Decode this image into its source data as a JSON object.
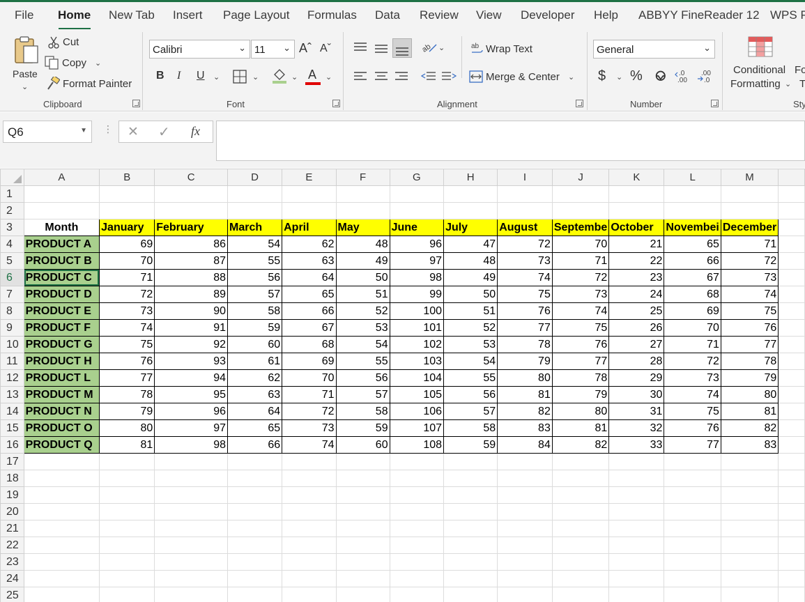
{
  "ribbon_tabs": [
    {
      "label": "File"
    },
    {
      "label": "Home"
    },
    {
      "label": "New Tab"
    },
    {
      "label": "Insert"
    },
    {
      "label": "Page Layout"
    },
    {
      "label": "Formulas"
    },
    {
      "label": "Data"
    },
    {
      "label": "Review"
    },
    {
      "label": "View"
    },
    {
      "label": "Developer"
    },
    {
      "label": "Help"
    },
    {
      "label": "ABBYY FineReader 12"
    },
    {
      "label": "WPS P"
    }
  ],
  "active_tab": "Home",
  "clipboard": {
    "paste_label": "Paste",
    "cut_label": "Cut",
    "copy_label": "Copy",
    "format_painter_label": "Format Painter",
    "group_label": "Clipboard"
  },
  "font": {
    "family": "Calibri",
    "size": "11",
    "increase_label": "Aˆ",
    "decrease_label": "Aˇ",
    "bold_label": "B",
    "italic_label": "I",
    "underline_label": "U",
    "color_label": "A",
    "group_label": "Font"
  },
  "alignment": {
    "wrap_text_label": "Wrap Text",
    "merge_center_label": "Merge & Center",
    "group_label": "Alignment"
  },
  "number": {
    "format": "General",
    "currency_label": "$",
    "percent_label": "%",
    "comma_label": "̦",
    "group_label": "Number"
  },
  "styles": {
    "conditional_label_1": "Conditional",
    "conditional_label_2": "Formatting",
    "format_label_1": "Fo",
    "format_label_2": "T",
    "group_label": "Sty"
  },
  "formula_bar": {
    "name_box": "Q6",
    "fx_label": "fx",
    "formula": ""
  },
  "sheet": {
    "columns": [
      "A",
      "B",
      "C",
      "D",
      "E",
      "F",
      "G",
      "H",
      "I",
      "J",
      "K",
      "L",
      "M"
    ],
    "row_numbers": [
      "1",
      "2",
      "3",
      "4",
      "5",
      "6",
      "7",
      "8",
      "9",
      "10",
      "11",
      "12",
      "13",
      "14",
      "15",
      "16",
      "17",
      "18",
      "19",
      "20",
      "21",
      "22",
      "23",
      "24",
      "25"
    ],
    "header_label": "Month",
    "months": [
      "January",
      "February",
      "March",
      "April",
      "May",
      "June",
      "July",
      "August",
      "Septembe",
      "October",
      "Novembei",
      "December"
    ],
    "products": [
      {
        "name": "PRODUCT A",
        "values": [
          "69",
          "86",
          "54",
          "62",
          "48",
          "96",
          "47",
          "72",
          "70",
          "21",
          "65",
          "71"
        ]
      },
      {
        "name": "PRODUCT B",
        "values": [
          "70",
          "87",
          "55",
          "63",
          "49",
          "97",
          "48",
          "73",
          "71",
          "22",
          "66",
          "72"
        ]
      },
      {
        "name": "PRODUCT C",
        "values": [
          "71",
          "88",
          "56",
          "64",
          "50",
          "98",
          "49",
          "74",
          "72",
          "23",
          "67",
          "73"
        ]
      },
      {
        "name": "PRODUCT D",
        "values": [
          "72",
          "89",
          "57",
          "65",
          "51",
          "99",
          "50",
          "75",
          "73",
          "24",
          "68",
          "74"
        ]
      },
      {
        "name": "PRODUCT E",
        "values": [
          "73",
          "90",
          "58",
          "66",
          "52",
          "100",
          "51",
          "76",
          "74",
          "25",
          "69",
          "75"
        ]
      },
      {
        "name": "PRODUCT F",
        "values": [
          "74",
          "91",
          "59",
          "67",
          "53",
          "101",
          "52",
          "77",
          "75",
          "26",
          "70",
          "76"
        ]
      },
      {
        "name": "PRODUCT G",
        "values": [
          "75",
          "92",
          "60",
          "68",
          "54",
          "102",
          "53",
          "78",
          "76",
          "27",
          "71",
          "77"
        ]
      },
      {
        "name": "PRODUCT H",
        "values": [
          "76",
          "93",
          "61",
          "69",
          "55",
          "103",
          "54",
          "79",
          "77",
          "28",
          "72",
          "78"
        ]
      },
      {
        "name": "PRODUCT L",
        "values": [
          "77",
          "94",
          "62",
          "70",
          "56",
          "104",
          "55",
          "80",
          "78",
          "29",
          "73",
          "79"
        ]
      },
      {
        "name": "PRODUCT M",
        "values": [
          "78",
          "95",
          "63",
          "71",
          "57",
          "105",
          "56",
          "81",
          "79",
          "30",
          "74",
          "80"
        ]
      },
      {
        "name": "PRODUCT N",
        "values": [
          "79",
          "96",
          "64",
          "72",
          "58",
          "106",
          "57",
          "82",
          "80",
          "31",
          "75",
          "81"
        ]
      },
      {
        "name": "PRODUCT O",
        "values": [
          "80",
          "97",
          "65",
          "73",
          "59",
          "107",
          "58",
          "83",
          "81",
          "32",
          "76",
          "82"
        ]
      },
      {
        "name": "PRODUCT Q",
        "values": [
          "81",
          "98",
          "66",
          "74",
          "60",
          "108",
          "59",
          "84",
          "82",
          "33",
          "77",
          "83"
        ]
      }
    ]
  },
  "colors": {
    "accent": "#1e7145",
    "month_header_fill": "#ffff00",
    "product_fill": "#a9d08e"
  }
}
